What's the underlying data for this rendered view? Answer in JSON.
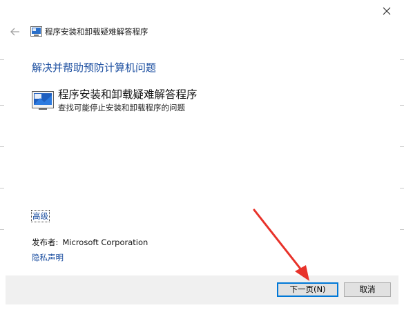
{
  "window": {
    "title": "程序安装和卸载疑难解答程序"
  },
  "icons": {
    "close": "close-icon",
    "back": "back-arrow-icon",
    "title": "troubleshooter-title-icon",
    "tool": "troubleshooter-tool-icon"
  },
  "main": {
    "heading": "解决并帮助预防计算机问题",
    "tool_title": "程序安装和卸载疑难解答程序",
    "tool_desc": "查找可能停止安装和卸载程序的问题",
    "advanced_link": "高级",
    "publisher_label": "发布者:",
    "publisher_value": "Microsoft Corporation",
    "privacy_link": "隐私声明"
  },
  "footer": {
    "next_label": "下一页(N)",
    "cancel_label": "取消"
  },
  "colors": {
    "link": "#1b4ea0",
    "footer_bg": "#f0f0f0",
    "default_button_border": "#0078d7",
    "annotation_arrow": "#e8322a"
  }
}
